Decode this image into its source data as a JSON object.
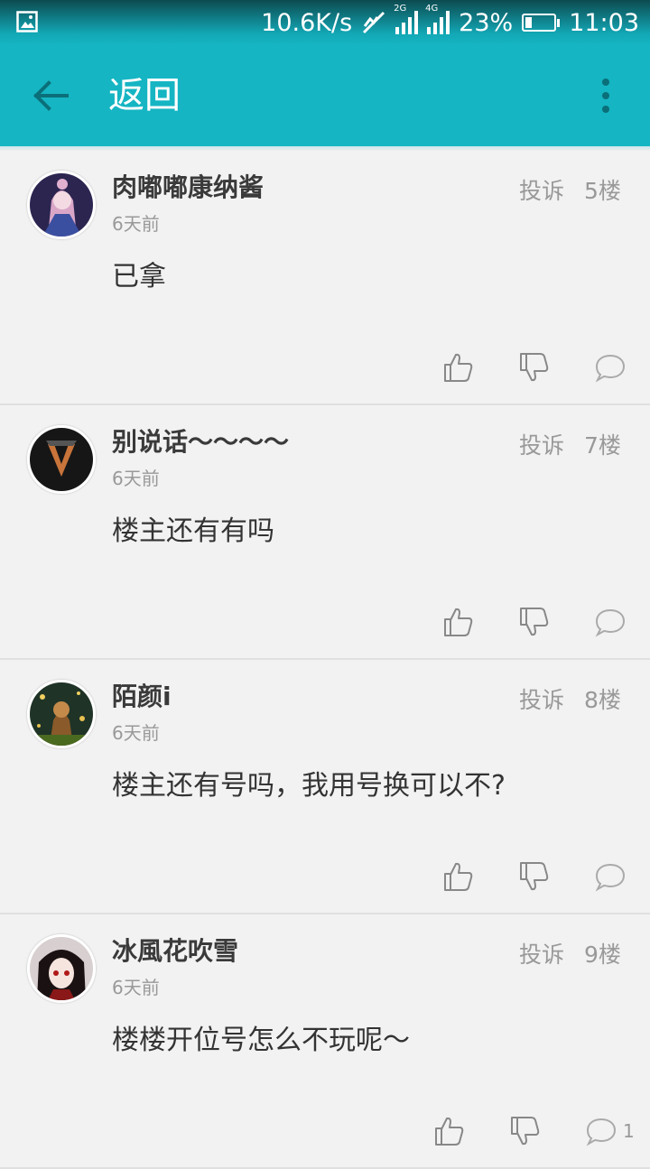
{
  "status_bar": {
    "net_speed": "10.6K/s",
    "sim1_label": "2G",
    "sim2_label": "4G",
    "battery_percent": "23%",
    "battery_level": 0.23,
    "time": "11:03"
  },
  "header": {
    "back_icon": "arrow-left-icon",
    "title": "返回",
    "more_icon": "more-vert-icon"
  },
  "comments": [
    {
      "username": "肉嘟嘟康纳酱",
      "time": "6天前",
      "report_label": "投诉",
      "floor": "5楼",
      "content": "已拿",
      "reply_count": ""
    },
    {
      "username": "别说话～～～～",
      "time": "6天前",
      "report_label": "投诉",
      "floor": "7楼",
      "content": "楼主还有有吗",
      "reply_count": ""
    },
    {
      "username": "陌颜i",
      "time": "6天前",
      "report_label": "投诉",
      "floor": "8楼",
      "content": "楼主还有号吗，我用号换可以不?",
      "reply_count": ""
    },
    {
      "username": "冰風花吹雪",
      "time": "6天前",
      "report_label": "投诉",
      "floor": "9楼",
      "content": "楼楼开位号怎么不玩呢～",
      "reply_count": "1"
    }
  ],
  "colors": {
    "accent": "#15b5c3",
    "background": "#f2f2f2",
    "muted_text": "#999999"
  }
}
